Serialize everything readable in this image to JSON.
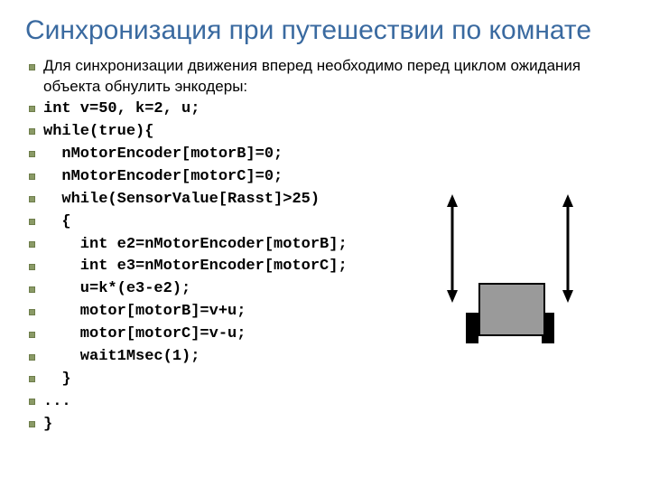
{
  "title": "Синхронизация при путешествии по комнате",
  "bullets": [
    {
      "text": "Для синхронизации движения вперед необходимо перед циклом ожидания объекта обнулить энкодеры:",
      "cls": "prose"
    },
    {
      "text": "int v=50, k=2, u;",
      "cls": "code"
    },
    {
      "text": "while(true){",
      "cls": "code"
    },
    {
      "text": "  nMotorEncoder[motorB]=0;",
      "cls": "code"
    },
    {
      "text": "  nMotorEncoder[motorC]=0;",
      "cls": "code"
    },
    {
      "text": "  while(SensorValue[Rasst]>25)",
      "cls": "code"
    },
    {
      "text": "  {",
      "cls": "code"
    },
    {
      "text": "    int e2=nMotorEncoder[motorB];",
      "cls": "code"
    },
    {
      "text": "    int e3=nMotorEncoder[motorC];",
      "cls": "code"
    },
    {
      "text": "    u=k*(e3-e2);",
      "cls": "code"
    },
    {
      "text": "    motor[motorB]=v+u;",
      "cls": "code"
    },
    {
      "text": "    motor[motorC]=v-u;",
      "cls": "code"
    },
    {
      "text": "    wait1Msec(1);",
      "cls": "code"
    },
    {
      "text": "  }",
      "cls": "code"
    },
    {
      "text": "...",
      "cls": "code"
    },
    {
      "text": "}",
      "cls": "code"
    }
  ],
  "diagram": {
    "name": "robot-sync-diagram",
    "left_arrow": "direction-arrow-left",
    "right_arrow": "direction-arrow-right",
    "body": "robot-body",
    "wheel_l": "robot-wheel-left",
    "wheel_r": "robot-wheel-right"
  }
}
